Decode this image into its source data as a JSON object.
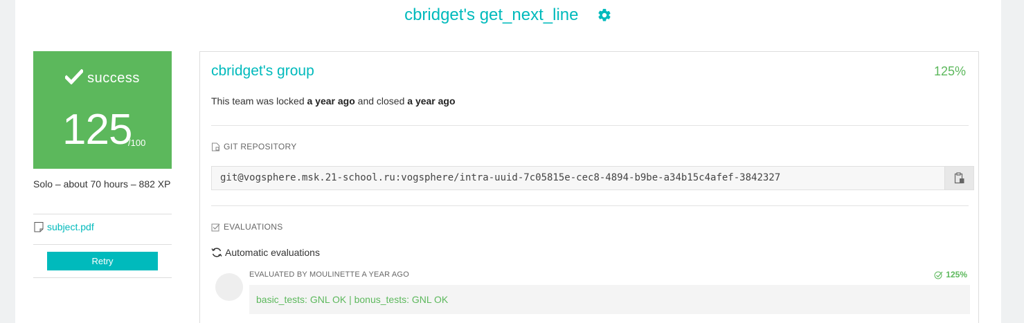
{
  "header": {
    "title": "cbridget's get_next_line",
    "settings_icon": "gear-icon"
  },
  "score_card": {
    "status": "success",
    "score": "125",
    "max": "/100",
    "color": "#5cb85c"
  },
  "meta": {
    "summary": "Solo – about 70 hours – 882 XP",
    "subject_link": "subject.pdf",
    "retry_label": "Retry"
  },
  "team": {
    "name": "cbridget's group",
    "percent": "125%",
    "lock_prefix": "This team was locked ",
    "locked_when": "a year ago",
    "lock_middle": " and closed ",
    "closed_when": "a year ago"
  },
  "repository": {
    "heading": "GIT REPOSITORY",
    "url": "git@vogsphere.msk.21-school.ru:vogsphere/intra-uuid-7c05815e-cec8-4894-b9be-a34b15c4afef-3842327"
  },
  "evaluations": {
    "heading": "EVALUATIONS",
    "automatic_label": "Automatic evaluations",
    "items": [
      {
        "evaluated_by": "EVALUATED BY MOULINETTE A YEAR AGO",
        "percent": "125%",
        "result": "basic_tests: GNL OK | bonus_tests: GNL OK"
      }
    ]
  },
  "colors": {
    "accent": "#00babc",
    "success": "#5cb85c"
  }
}
